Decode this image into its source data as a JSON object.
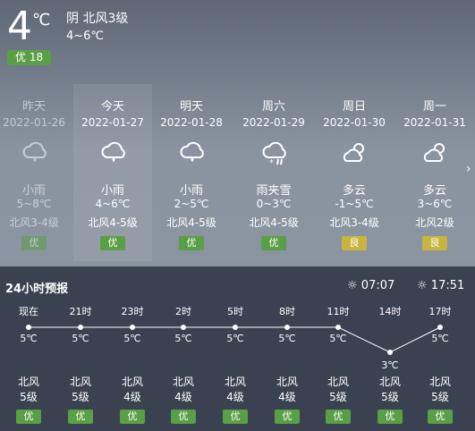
{
  "current": {
    "temp": "4",
    "unit": "℃",
    "condition": "阴  北风3级",
    "range": "4~6℃",
    "aqi": "优 18"
  },
  "days": [
    {
      "name": "昨天",
      "date": "2022-01-26",
      "icon": "rain-icon",
      "cond": "小雨",
      "temp": "5~8℃",
      "wind": "北风3-4级",
      "aqi": "优",
      "past": true
    },
    {
      "name": "今天",
      "date": "2022-01-27",
      "icon": "rain-icon",
      "cond": "小雨",
      "temp": "4~6℃",
      "wind": "北风4-5级",
      "aqi": "优",
      "today": true
    },
    {
      "name": "明天",
      "date": "2022-01-28",
      "icon": "rain-icon",
      "cond": "小雨",
      "temp": "2~5℃",
      "wind": "北风4-5级",
      "aqi": "优"
    },
    {
      "name": "周六",
      "date": "2022-01-29",
      "icon": "sleet-icon",
      "cond": "雨夹雪",
      "temp": "0~3℃",
      "wind": "北风4-5级",
      "aqi": "优"
    },
    {
      "name": "周日",
      "date": "2022-01-30",
      "icon": "partly-cloudy-icon",
      "cond": "多云",
      "temp": "-1~5℃",
      "wind": "北风3-4级",
      "aqi": "良"
    },
    {
      "name": "周一",
      "date": "2022-01-31",
      "icon": "partly-cloudy-icon",
      "cond": "多云",
      "temp": "3~6℃",
      "wind": "北风2级",
      "aqi": "良"
    }
  ],
  "hourly": {
    "title": "24小时预报",
    "sunrise": "07:07",
    "sunset": "17:51",
    "items": [
      {
        "time": "现在",
        "temp": "5℃",
        "t": 5,
        "wind_dir": "北风",
        "wind_lvl": "5级",
        "aqi": "优"
      },
      {
        "time": "21时",
        "temp": "5℃",
        "t": 5,
        "wind_dir": "北风",
        "wind_lvl": "5级",
        "aqi": "优"
      },
      {
        "time": "23时",
        "temp": "5℃",
        "t": 5,
        "wind_dir": "北风",
        "wind_lvl": "4级",
        "aqi": "优"
      },
      {
        "time": "2时",
        "temp": "5℃",
        "t": 5,
        "wind_dir": "北风",
        "wind_lvl": "4级",
        "aqi": "优"
      },
      {
        "time": "5时",
        "temp": "5℃",
        "t": 5,
        "wind_dir": "北风",
        "wind_lvl": "4级",
        "aqi": "优"
      },
      {
        "time": "8时",
        "temp": "5℃",
        "t": 5,
        "wind_dir": "北风",
        "wind_lvl": "4级",
        "aqi": "优"
      },
      {
        "time": "11时",
        "temp": "5℃",
        "t": 5,
        "wind_dir": "北风",
        "wind_lvl": "5级",
        "aqi": "优"
      },
      {
        "time": "14时",
        "temp": "3℃",
        "t": 3,
        "wind_dir": "北风",
        "wind_lvl": "5级",
        "aqi": "优"
      },
      {
        "time": "17时",
        "temp": "5℃",
        "t": 5,
        "wind_dir": "北风",
        "wind_lvl": "5级",
        "aqi": "优"
      }
    ]
  },
  "colors": {
    "aqi_good": "#5a9e45",
    "aqi_moderate": "#c8b540"
  }
}
